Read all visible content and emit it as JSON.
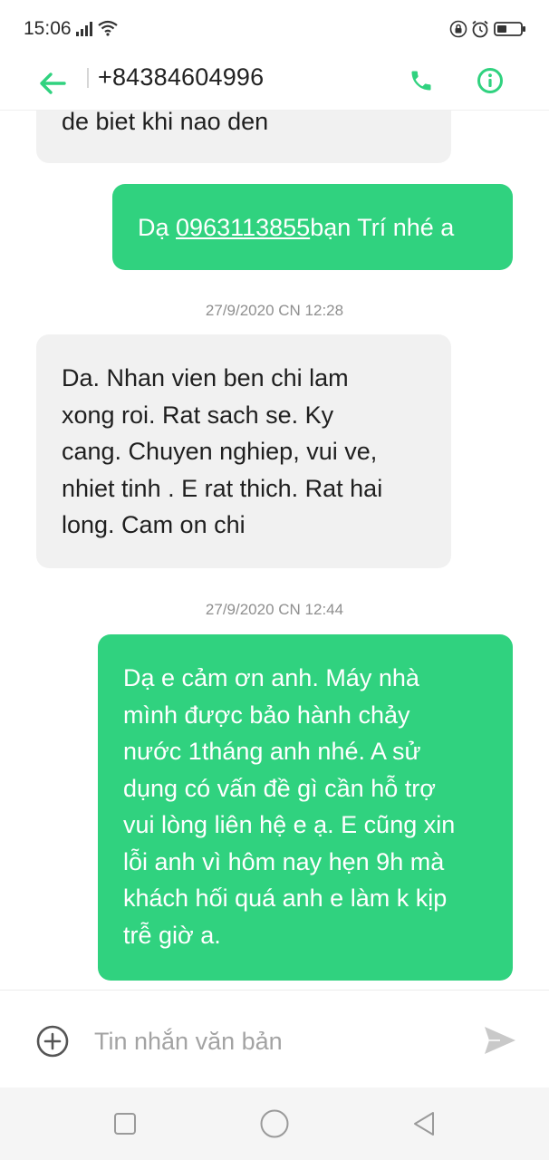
{
  "status_bar": {
    "time": "15:06",
    "icons": [
      "signal-icon",
      "wifi-icon",
      "lock-rotation-icon",
      "alarm-icon",
      "battery-icon"
    ]
  },
  "header": {
    "contact": "+84384604996",
    "back_icon": "arrow-left-icon",
    "call_icon": "phone-icon",
    "info_icon": "info-icon"
  },
  "messages": [
    {
      "direction": "incoming",
      "text": "de biet khi nao den"
    },
    {
      "direction": "outgoing",
      "prefix": "Dạ ",
      "link": "0963113855",
      "suffix": "bạn Trí nhé a"
    },
    {
      "type": "timestamp",
      "text": "27/9/2020 CN 12:28"
    },
    {
      "direction": "incoming",
      "text": "Da. Nhan vien ben chi lam\nxong roi. Rat sach se. Ky\ncang. Chuyen nghiep, vui ve,\nnhiet tinh . E rat thich. Rat hai\nlong. Cam on chi"
    },
    {
      "type": "timestamp",
      "text": "27/9/2020 CN 12:44"
    },
    {
      "direction": "outgoing",
      "text": "Dạ e cảm ơn anh. Máy nhà\nmình được bảo hành chảy\nnước 1tháng anh nhé. A sử\ndụng có vấn đề gì cần hỗ trợ\nvui lòng liên hệ e ạ. E cũng xin\nlỗi anh vì hôm nay hẹn 9h mà\nkhách hối quá anh e làm k kịp\ntrễ giờ a."
    }
  ],
  "composer": {
    "placeholder": "Tin nhắn văn bản",
    "value": "",
    "add_icon": "plus-circle-icon",
    "send_icon": "send-icon"
  },
  "navbar": {
    "icons": [
      "recents-square-icon",
      "home-circle-icon",
      "back-triangle-icon"
    ]
  },
  "colors": {
    "accent_green": "#30d27f",
    "incoming_bubble": "#f1f1f1",
    "timestamp": "#8f8f8f",
    "navbar_bg": "#f5f5f5"
  }
}
